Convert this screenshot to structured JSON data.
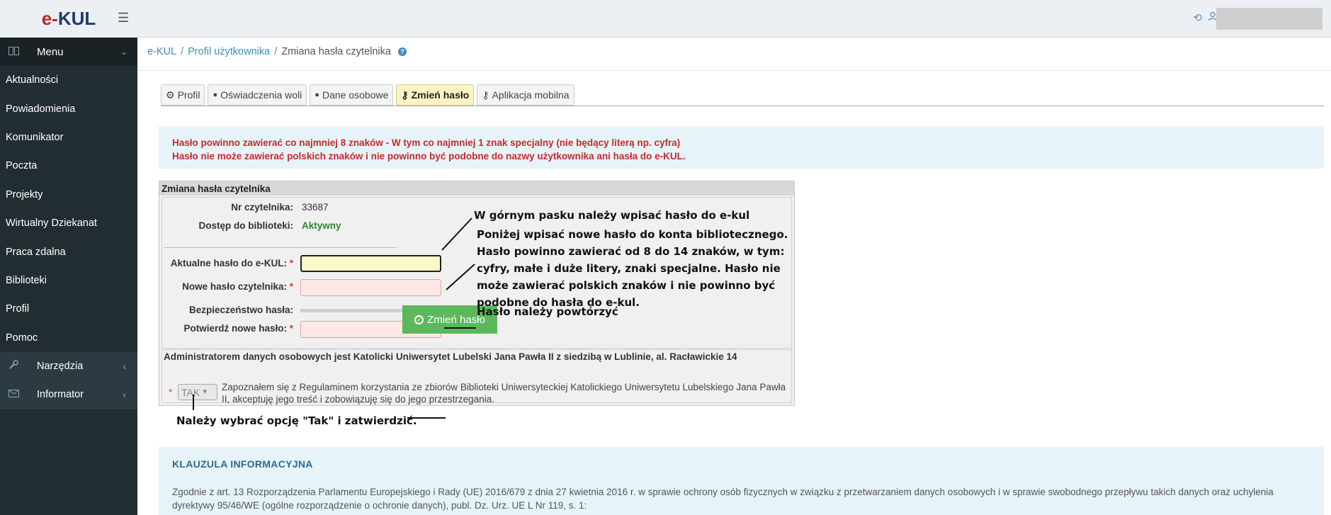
{
  "header": {
    "logo_e": "e-",
    "logo_kul": "KUL",
    "hamburger": "☰",
    "sync_icon": "⟲",
    "user_icon": "👤"
  },
  "sidebar": {
    "menu_label": "Menu",
    "items": [
      {
        "label": "Aktualności"
      },
      {
        "label": "Powiadomienia"
      },
      {
        "label": "Komunikator"
      },
      {
        "label": "Poczta"
      },
      {
        "label": "Projekty"
      },
      {
        "label": "Wirtualny Dziekanat"
      },
      {
        "label": "Praca zdalna"
      },
      {
        "label": "Biblioteki"
      },
      {
        "label": "Profil"
      },
      {
        "label": "Pomoc"
      }
    ],
    "group_items": [
      {
        "label": "Narzędzia"
      },
      {
        "label": "Informator"
      }
    ]
  },
  "breadcrumb": {
    "root": "e-KUL",
    "profile": "Profil użytkownika",
    "current": "Zmiana hasła czytelnika",
    "sep": "/"
  },
  "tabs": [
    {
      "label": "Profil",
      "icon": "⚙"
    },
    {
      "label": "Oświadczenia woli",
      "icon": "👤"
    },
    {
      "label": "Dane osobowe",
      "icon": "👤"
    },
    {
      "label": "Zmień hasło",
      "icon": "🔑"
    },
    {
      "label": "Aplikacja mobilna",
      "icon": "🔑"
    }
  ],
  "alert": {
    "line1": "Hasło powinno zawierać co najmniej 8 znaków - W tym co najmniej 1 znak specjalny (nie będący literą np. cyfra)",
    "line2": "Hasło nie może zawierać polskich znaków i nie powinno być podobne do nazwy użytkownika ani hasła do e-KUL."
  },
  "form": {
    "title": "Zmiana hasła czytelnika",
    "reader_no_label": "Nr czytelnika:",
    "reader_no_value": "33687",
    "access_label": "Dostęp do biblioteki:",
    "access_value": "Aktywny",
    "current_pw_label": "Aktualne hasło do e-KUL:",
    "new_pw_label": "Nowe hasło czytelnika:",
    "strength_label": "Bezpieczeństwo hasła:",
    "confirm_pw_label": "Potwierdź nowe hasło:",
    "required_mark": "*",
    "admin_text": "Administratorem danych osobowych jest Katolicki Uniwersytet Lubelski Jana Pawła II z siedzibą w Lublinie, al. Racławickie 14",
    "tak_value": "TAK",
    "consent_text": "Zapoznałem się z Regulaminem korzystania ze zbiorów Biblioteki Uniwersyteckiej Katolickiego Uniwersytetu Lubelskiego Jana Pawła II, akceptuję jego treść i zobowiązuję się do jego przestrzegania.",
    "submit_label": "Zmień hasło"
  },
  "klauzula": {
    "title": "KLAUZULA INFORMACYJNA",
    "text": "Zgodnie z art. 13 Rozporządzenia Parlamentu Europejskiego i Rady (UE) 2016/679 z dnia 27 kwietnia 2016 r. w sprawie ochrony osób fizycznych w związku z przetwarzaniem danych osobowych i w sprawie swobodnego przepływu takich danych oraz uchylenia dyrektywy 95/46/WE (ogólne rozporządzenie o ochronie danych), publ. Dz. Urz. UE L Nr 119, s. 1:"
  },
  "annotations": {
    "a1": "W górnym pasku należy wpisać hasło do e-kul",
    "a2_l1": "Poniżej wpisać nowe hasło do konta bibliotecznego.",
    "a2_l2": "Hasło powinno zawierać od 8 do 14 znaków, w tym:",
    "a2_l3": "cyfry, małe i duże litery, znaki specjalne. Hasło nie",
    "a2_l4": "może zawierać polskich znaków i nie powinno być",
    "a2_l5": "podobne do hasła do e-kul.",
    "a3": "Hasło należy powtórzyć",
    "a4": "Należy wybrać opcję \"Tak\" i zatwierdzić."
  },
  "colors": {
    "sidebar_bg": "#222d32",
    "accent": "#3c8dbc",
    "alert_text": "#c62b2b",
    "submit_bg": "#5cb85c",
    "active_tab": "#fcf3c4"
  }
}
